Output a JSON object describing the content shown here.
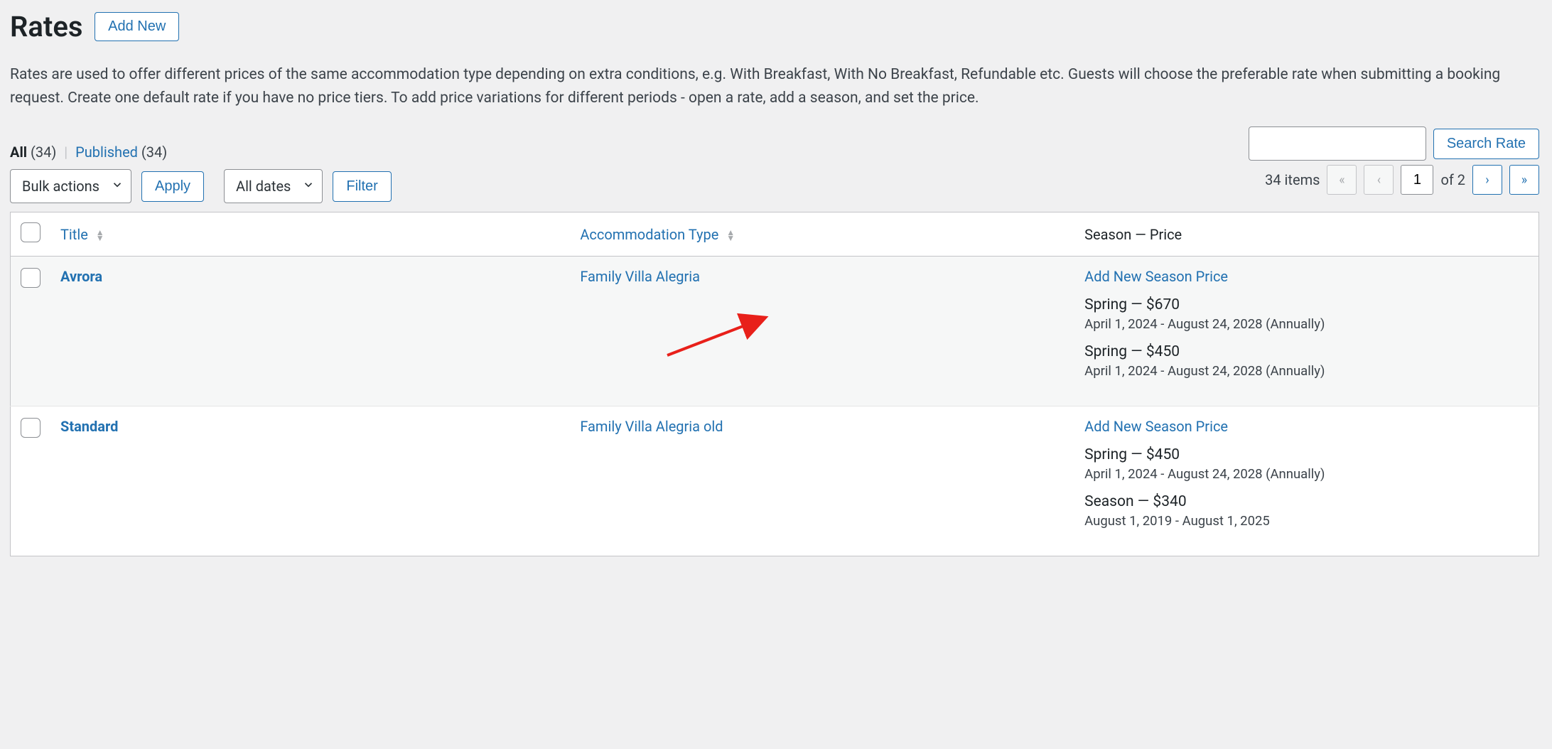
{
  "header": {
    "title": "Rates",
    "add_new": "Add New"
  },
  "description": "Rates are used to offer different prices of the same accommodation type depending on extra conditions, e.g. With Breakfast, With No Breakfast, Refundable etc. Guests will choose the preferable rate when submitting a booking request. Create one default rate if you have no price tiers. To add price variations for different periods - open a rate, add a season, and set the price.",
  "filters": {
    "all_label": "All",
    "all_count": "(34)",
    "published_label": "Published",
    "published_count": "(34)"
  },
  "search": {
    "value": "",
    "button": "Search Rate"
  },
  "bulk": {
    "select_label": "Bulk actions",
    "apply": "Apply",
    "date_label": "All dates",
    "filter": "Filter"
  },
  "pagination": {
    "items_label": "34 items",
    "current": "1",
    "of_label": "of 2"
  },
  "columns": {
    "title": "Title",
    "accommodation": "Accommodation Type",
    "season_price": "Season — Price"
  },
  "add_new_season_label": "Add New Season Price",
  "rows": [
    {
      "title": "Avrora",
      "accommodation": "Family Villa Alegria",
      "seasons": [
        {
          "label": "Spring — $670",
          "sub": "April 1, 2024 - August 24, 2028 (Annually)"
        },
        {
          "label": "Spring — $450",
          "sub": "April 1, 2024 - August 24, 2028 (Annually)"
        }
      ]
    },
    {
      "title": "Standard",
      "accommodation": "Family Villa Alegria old",
      "seasons": [
        {
          "label": "Spring — $450",
          "sub": "April 1, 2024 - August 24, 2028 (Annually)"
        },
        {
          "label": "Season — $340",
          "sub": "August 1, 2019 - August 1, 2025"
        }
      ]
    }
  ]
}
